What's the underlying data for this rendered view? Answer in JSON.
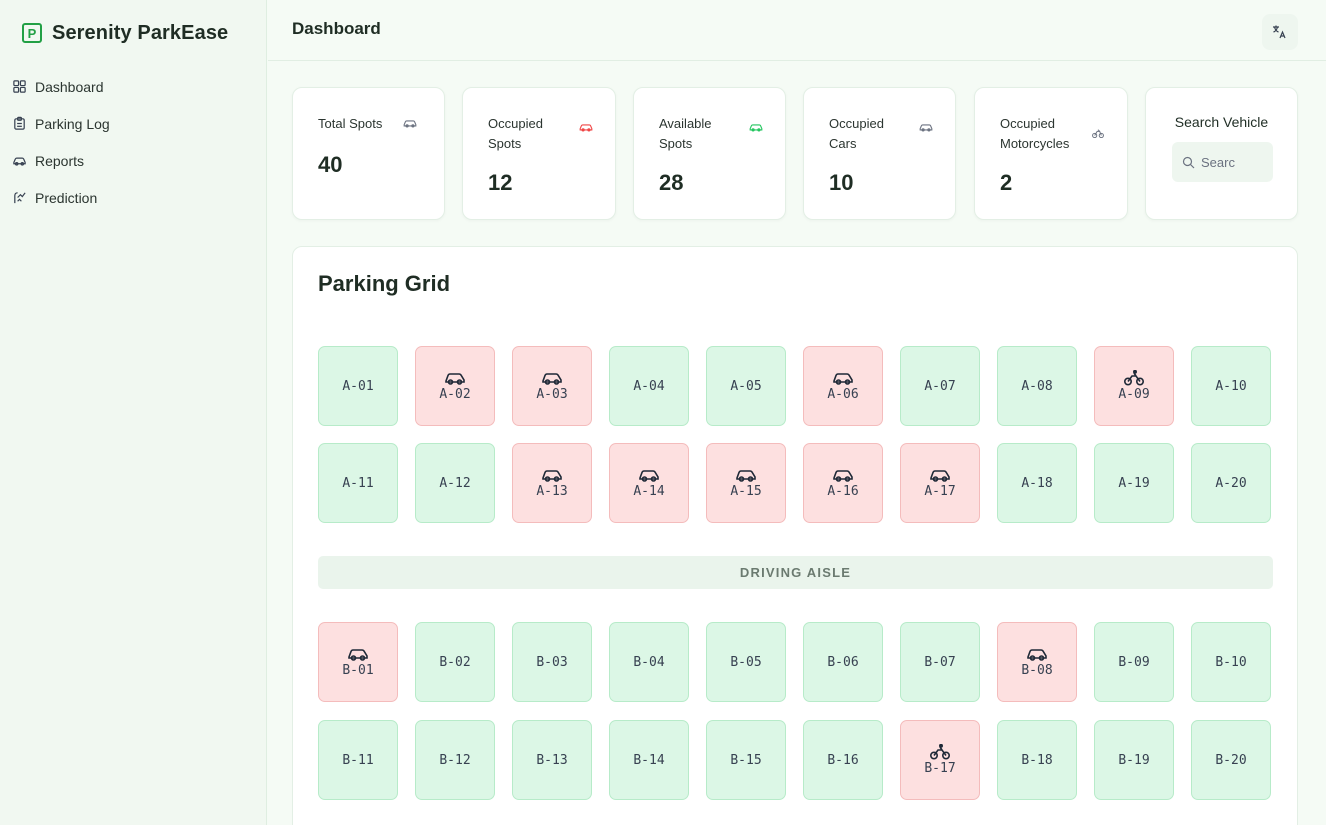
{
  "app": {
    "name": "Serenity ParkEase",
    "logo_letter": "P",
    "brand_color": "#22a045"
  },
  "sidebar": {
    "items": [
      {
        "label": "Dashboard",
        "icon": "grid-icon"
      },
      {
        "label": "Parking Log",
        "icon": "clipboard-icon"
      },
      {
        "label": "Reports",
        "icon": "car-icon"
      },
      {
        "label": "Prediction",
        "icon": "activity-icon"
      }
    ]
  },
  "header": {
    "title": "Dashboard",
    "translate_icon": "translate-icon"
  },
  "stats": {
    "total": {
      "label": "Total Spots",
      "value": "40",
      "icon_color": "#6b7280"
    },
    "occupied": {
      "label": "Occupied Spots",
      "value": "12",
      "icon_color": "#ef4444"
    },
    "available": {
      "label": "Available Spots",
      "value": "28",
      "icon_color": "#22c55e"
    },
    "cars": {
      "label": "Occupied Cars",
      "value": "10",
      "icon_color": "#6b7280"
    },
    "motorcycles": {
      "label": "Occupied Motorcycles",
      "value": "2",
      "icon_color": "#6b7280"
    }
  },
  "search": {
    "title": "Search Vehicle",
    "placeholder": "Searc"
  },
  "parking_grid": {
    "title": "Parking Grid",
    "aisle_label": "DRIVING AISLE",
    "rows": [
      [
        {
          "id": "A-01",
          "vehicle": null
        },
        {
          "id": "A-02",
          "vehicle": "car"
        },
        {
          "id": "A-03",
          "vehicle": "car"
        },
        {
          "id": "A-04",
          "vehicle": null
        },
        {
          "id": "A-05",
          "vehicle": null
        },
        {
          "id": "A-06",
          "vehicle": "car"
        },
        {
          "id": "A-07",
          "vehicle": null
        },
        {
          "id": "A-08",
          "vehicle": null
        },
        {
          "id": "A-09",
          "vehicle": "motorcycle"
        },
        {
          "id": "A-10",
          "vehicle": null
        }
      ],
      [
        {
          "id": "A-11",
          "vehicle": null
        },
        {
          "id": "A-12",
          "vehicle": null
        },
        {
          "id": "A-13",
          "vehicle": "car"
        },
        {
          "id": "A-14",
          "vehicle": "car"
        },
        {
          "id": "A-15",
          "vehicle": "car"
        },
        {
          "id": "A-16",
          "vehicle": "car"
        },
        {
          "id": "A-17",
          "vehicle": "car"
        },
        {
          "id": "A-18",
          "vehicle": null
        },
        {
          "id": "A-19",
          "vehicle": null
        },
        {
          "id": "A-20",
          "vehicle": null
        }
      ],
      [
        {
          "id": "B-01",
          "vehicle": "car"
        },
        {
          "id": "B-02",
          "vehicle": null
        },
        {
          "id": "B-03",
          "vehicle": null
        },
        {
          "id": "B-04",
          "vehicle": null
        },
        {
          "id": "B-05",
          "vehicle": null
        },
        {
          "id": "B-06",
          "vehicle": null
        },
        {
          "id": "B-07",
          "vehicle": null
        },
        {
          "id": "B-08",
          "vehicle": "car"
        },
        {
          "id": "B-09",
          "vehicle": null
        },
        {
          "id": "B-10",
          "vehicle": null
        }
      ],
      [
        {
          "id": "B-11",
          "vehicle": null
        },
        {
          "id": "B-12",
          "vehicle": null
        },
        {
          "id": "B-13",
          "vehicle": null
        },
        {
          "id": "B-14",
          "vehicle": null
        },
        {
          "id": "B-15",
          "vehicle": null
        },
        {
          "id": "B-16",
          "vehicle": null
        },
        {
          "id": "B-17",
          "vehicle": "motorcycle"
        },
        {
          "id": "B-18",
          "vehicle": null
        },
        {
          "id": "B-19",
          "vehicle": null
        },
        {
          "id": "B-20",
          "vehicle": null
        }
      ]
    ]
  },
  "colors": {
    "free_bg": "#dcf7e6",
    "taken_bg": "#fde0e0",
    "page_bg": "#f5fbf5"
  }
}
